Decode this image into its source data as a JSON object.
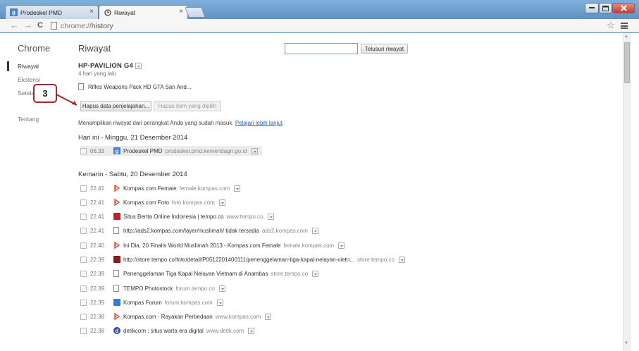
{
  "window": {
    "tabs": [
      {
        "title": "Prodeskel PMD",
        "active": false,
        "icon": "google-g-icon"
      },
      {
        "title": "Riwayat",
        "active": true,
        "icon": "history-icon"
      }
    ],
    "close_glyph": "×"
  },
  "toolbar": {
    "back": "←",
    "forward": "→",
    "reload": "C",
    "url_scheme": "chrome://",
    "url_path": "history",
    "star": "☆"
  },
  "sidebar": {
    "title": "Chrome",
    "items": [
      {
        "label": "Riwayat",
        "active": true
      },
      {
        "label": "Ekstensi",
        "active": false
      },
      {
        "label": "Setelan",
        "active": false
      },
      {
        "label": "Tentang",
        "active": false
      }
    ]
  },
  "page": {
    "title": "Riwayat",
    "search_placeholder": "",
    "search_button": "Telusuri riwayat"
  },
  "device": {
    "name": "HP-PAVILION G4",
    "time_ago": "4 hari yang lalu",
    "entry": "Rifles Weapons Pack HD GTA San And..."
  },
  "actions": {
    "clear_label": "Hapus data penjelajahan...",
    "remove_label": "Hapus item yang dipilih"
  },
  "callout": "3",
  "info": {
    "text": "Menampilkan riwayat dari perangkat Anda yang sudah masuk.",
    "link": "Pelajari lebih lanjut"
  },
  "days": [
    {
      "header": "Hari ini - Minggu, 21 Desember 2014",
      "entries": [
        {
          "time": "06.33",
          "title": "Prodeskel PMD",
          "domain": "prodeskel.pmd.kemendagri.go.id",
          "icon": "google-g-icon"
        }
      ]
    },
    {
      "header": "Kemarin - Sabtu, 20 Desember 2014",
      "entries": [
        {
          "time": "22.41",
          "title": "Kompas.com Female",
          "domain": "female.kompas.com",
          "icon": "kompas-icon"
        },
        {
          "time": "22.41",
          "title": "Kompas.com Foto",
          "domain": "foto.kompas.com",
          "icon": "kompas-icon"
        },
        {
          "time": "22.41",
          "title": "Situs Berita Online Indonesia | tempo.co",
          "domain": "www.tempo.co",
          "icon": "tempo-icon"
        },
        {
          "time": "22.41",
          "title": "http://ads2.kompas.com/layer/muslimah/ tidak tersedia",
          "domain": "ads2.kompas.com",
          "icon": "page-icon"
        },
        {
          "time": "22.40",
          "title": "Ini Dia, 20 Finalis World Muslimah 2013 - Kompas.com Female",
          "domain": "female.kompas.com",
          "icon": "kompas-icon"
        },
        {
          "time": "22.39",
          "title": "http://store.tempo.co/foto/detail/P0512201400111/penenggelaman-tiga-kapal-nelayan-vietn...",
          "domain": "store.tempo.co",
          "icon": "tempo-store-icon"
        },
        {
          "time": "22.39",
          "title": "Penenggelaman Tiga Kapal Nelayan Vietnam di Anambas",
          "domain": "store.tempo.co",
          "icon": "page-icon"
        },
        {
          "time": "22.39",
          "title": "TEMPO Photostock",
          "domain": "forum.tempo.co",
          "icon": "page-icon"
        },
        {
          "time": "22.39",
          "title": "Kompas Forum",
          "domain": "forum.kompas.com",
          "icon": "kompas-forum-icon"
        },
        {
          "time": "22.38",
          "title": "Kompas.com - Rayakan Perbedaan",
          "domain": "www.kompas.com",
          "icon": "kompas-icon"
        },
        {
          "time": "22.38",
          "title": "detikcom : situs warta era digital",
          "domain": "www.detik.com",
          "icon": "detik-icon"
        }
      ]
    }
  ]
}
